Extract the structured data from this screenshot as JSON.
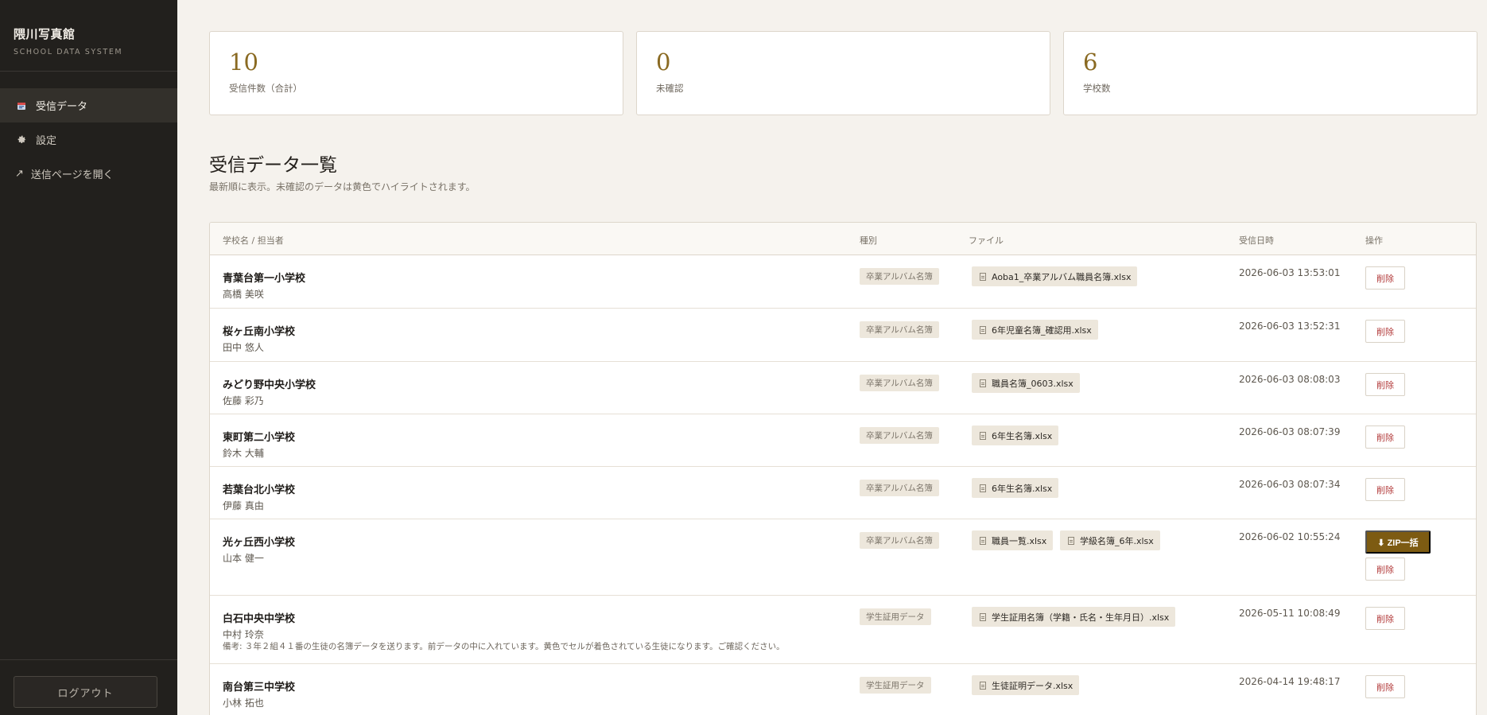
{
  "brand": {
    "title": "隈川写真館",
    "subtitle": "SCHOOL DATA SYSTEM"
  },
  "sidebar": {
    "items": [
      {
        "label": "受信データ",
        "icon": "inbox-icon",
        "active": true
      },
      {
        "label": "設定",
        "icon": "gear-icon",
        "active": false
      },
      {
        "label": "送信ページを開く",
        "icon": "external-link-icon",
        "active": false
      }
    ],
    "logout_label": "ログアウト"
  },
  "stats": [
    {
      "value": "10",
      "label": "受信件数（合計）"
    },
    {
      "value": "0",
      "label": "未確認"
    },
    {
      "value": "6",
      "label": "学校数"
    }
  ],
  "page": {
    "title": "受信データ一覧",
    "description": "最新順に表示。未確認のデータは黄色でハイライトされます。"
  },
  "table": {
    "headers": [
      "学校名 / 担当者",
      "種別",
      "ファイル",
      "受信日時",
      "操作"
    ],
    "delete_label": "削除",
    "zip_label": "⬇ ZIP一括",
    "rows": [
      {
        "school": "青葉台第一小学校",
        "person": "高橋 美咲",
        "type": "卒業アルバム名簿",
        "files": [
          "Aoba1_卒業アルバム職員名簿.xlsx"
        ],
        "date": "2026-06-03 13:53:01"
      },
      {
        "school": "桜ヶ丘南小学校",
        "person": "田中 悠人",
        "type": "卒業アルバム名簿",
        "files": [
          "6年児童名簿_確認用.xlsx"
        ],
        "date": "2026-06-03 13:52:31"
      },
      {
        "school": "みどり野中央小学校",
        "person": "佐藤 彩乃",
        "type": "卒業アルバム名簿",
        "files": [
          "職員名簿_0603.xlsx"
        ],
        "date": "2026-06-03 08:08:03"
      },
      {
        "school": "東町第二小学校",
        "person": "鈴木 大輔",
        "type": "卒業アルバム名簿",
        "files": [
          "6年生名簿.xlsx"
        ],
        "date": "2026-06-03 08:07:39"
      },
      {
        "school": "若葉台北小学校",
        "person": "伊藤 真由",
        "type": "卒業アルバム名簿",
        "files": [
          "6年生名簿.xlsx"
        ],
        "date": "2026-06-03 08:07:34"
      },
      {
        "school": "光ヶ丘西小学校",
        "person": "山本 健一",
        "type": "卒業アルバム名簿",
        "files": [
          "職員一覧.xlsx",
          "学級名簿_6年.xlsx"
        ],
        "date": "2026-06-02 10:55:24"
      },
      {
        "school": "白石中央中学校",
        "person": "中村 玲奈",
        "note": "備考: ３年２組４１番の生徒の名簿データを送ります。前データの中に入れています。黄色でセルが着色されている生徒になります。ご確認ください。",
        "type": "学生証用データ",
        "files": [
          "学生証用名簿（学籍・氏名・生年月日）.xlsx"
        ],
        "date": "2026-05-11 10:08:49"
      },
      {
        "school": "南台第三中学校",
        "person": "小林 拓也",
        "type": "学生証用データ",
        "files": [
          "生徒証明データ.xlsx"
        ],
        "date": "2026-04-14 19:48:17"
      }
    ]
  }
}
